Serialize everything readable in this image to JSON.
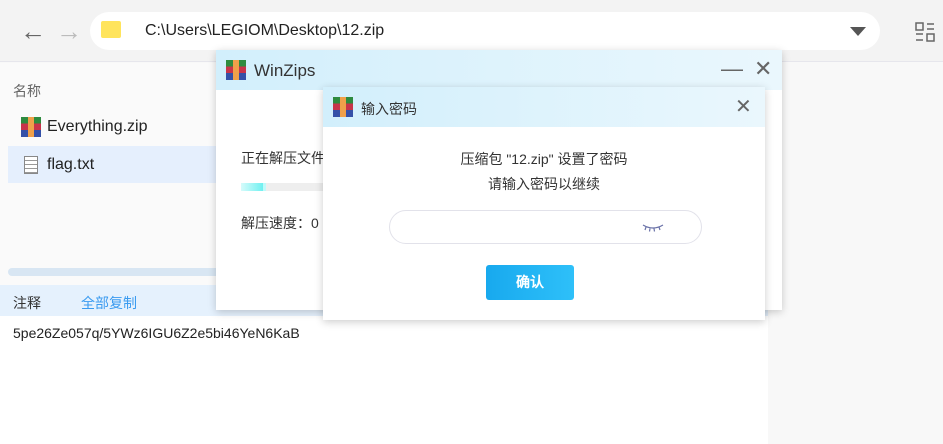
{
  "toolbar": {
    "back_icon": "arrow-left",
    "forward_icon": "arrow-right",
    "path": "C:\\Users\\LEGIOM\\Desktop\\12.zip",
    "view_icon": "view-toggle-icon"
  },
  "file_list": {
    "header": "名称",
    "items": [
      {
        "name": "Everything.zip",
        "icon": "zip-icon"
      },
      {
        "name": "flag.txt",
        "icon": "text-file-icon",
        "selected": true
      }
    ]
  },
  "comment_bar": {
    "label": "注释",
    "copy_all": "全部复制",
    "text": "5pe26Ze057q/5YWz6IGU6Z2e5bi46YeN6KaB"
  },
  "winzips": {
    "title": "WinZips",
    "minimize": "—",
    "close": "✕",
    "status": "正在解压文件",
    "progress": 0.05,
    "speed": "解压速度：0"
  },
  "password_dialog": {
    "title": "输入密码",
    "close": "✕",
    "line1": "压缩包 \"12.zip\" 设置了密码",
    "line2": "请输入密码以继续",
    "password_value": "",
    "confirm": "确认"
  },
  "colors": {
    "accent": "#1ab0f0",
    "selection": "#e5effd"
  }
}
